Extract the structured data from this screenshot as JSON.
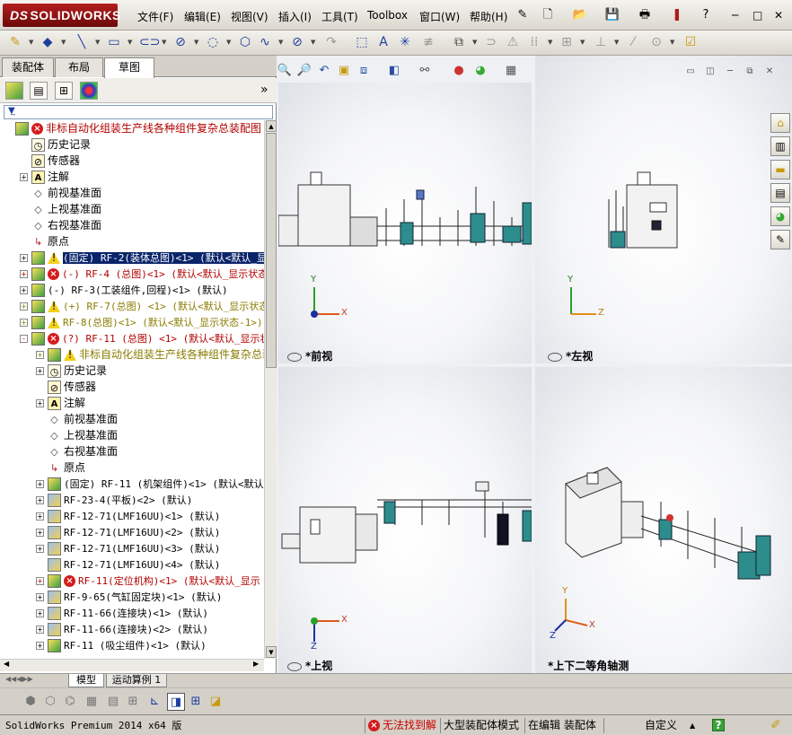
{
  "app": {
    "logo_text": "SOLIDWORKS",
    "logo_prefix": "DS",
    "brand_color": "#8b1414"
  },
  "menu": {
    "items": [
      "文件(F)",
      "编辑(E)",
      "视图(V)",
      "插入(I)",
      "工具(T)",
      "Toolbox",
      "窗口(W)",
      "帮助(H)"
    ]
  },
  "window_controls": {
    "minimize": "─",
    "restore": "□",
    "close": "✕"
  },
  "left_panel": {
    "tabs": [
      "装配体",
      "布局",
      "草图"
    ],
    "active_tab": "草图",
    "expand_symbol": "»",
    "tree": [
      {
        "label": "非标自动化组装生产线各种组件复杂总装配图",
        "icon": "asm",
        "status": "error",
        "color": "red",
        "indent": 0
      },
      {
        "label": "历史记录",
        "icon": "hist",
        "indent": 1
      },
      {
        "label": "传感器",
        "icon": "sens",
        "indent": 1
      },
      {
        "label": "注解",
        "icon": "ann",
        "indent": 1,
        "expander": "+"
      },
      {
        "label": "前视基准面",
        "icon": "plane",
        "indent": 1
      },
      {
        "label": "上视基准面",
        "icon": "plane",
        "indent": 1
      },
      {
        "label": "右视基准面",
        "icon": "plane",
        "indent": 1
      },
      {
        "label": "原点",
        "icon": "origin",
        "indent": 1
      },
      {
        "label": "(固定) RF-2(装体总图)<1> (默认<默认_显",
        "icon": "asm",
        "status": "warn",
        "indent": 1,
        "expander": "+",
        "selected": true
      },
      {
        "label": "(-) RF-4 (总图)<1> (默认<默认_显示状态",
        "icon": "asm",
        "status": "error",
        "color": "red",
        "indent": 1,
        "expander": "+"
      },
      {
        "label": "(-) RF-3(工装组件,回程)<1> (默认)",
        "icon": "asm",
        "indent": 1,
        "expander": "+"
      },
      {
        "label": "(+) RF-7(总图) <1> (默认<默认_显示状态",
        "icon": "asm",
        "status": "warn",
        "color": "olive",
        "indent": 1,
        "expander": "+"
      },
      {
        "label": "RF-8(总图)<1> (默认<默认_显示状态-1>)",
        "icon": "asm",
        "status": "warn",
        "color": "olive",
        "indent": 1,
        "expander": "+"
      },
      {
        "label": "(?) RF-11 (总图) <1> (默认<默认_显示状",
        "icon": "asm",
        "status": "error",
        "color": "red",
        "indent": 1,
        "expander": "-"
      },
      {
        "label": "非标自动化组装生产线各种组件复杂总装",
        "icon": "asm",
        "status": "warn",
        "color": "olive",
        "indent": 2,
        "expander": "+"
      },
      {
        "label": "历史记录",
        "icon": "hist",
        "indent": 2,
        "expander": "+"
      },
      {
        "label": "传感器",
        "icon": "sens",
        "indent": 2
      },
      {
        "label": "注解",
        "icon": "ann",
        "indent": 2,
        "expander": "+"
      },
      {
        "label": "前视基准面",
        "icon": "plane",
        "indent": 2
      },
      {
        "label": "上视基准面",
        "icon": "plane",
        "indent": 2
      },
      {
        "label": "右视基准面",
        "icon": "plane",
        "indent": 2
      },
      {
        "label": "原点",
        "icon": "origin",
        "indent": 2
      },
      {
        "label": "(固定) RF-11 (机架组件)<1> (默认<默认.",
        "icon": "asm",
        "indent": 2,
        "expander": "+"
      },
      {
        "label": "RF-23-4(平板)<2> (默认)",
        "icon": "part",
        "indent": 2,
        "expander": "+"
      },
      {
        "label": "RF-12-71(LMF16UU)<1> (默认)",
        "icon": "part",
        "indent": 2,
        "expander": "+"
      },
      {
        "label": "RF-12-71(LMF16UU)<2> (默认)",
        "icon": "part",
        "indent": 2,
        "expander": "+"
      },
      {
        "label": "RF-12-71(LMF16UU)<3> (默认)",
        "icon": "part",
        "indent": 2,
        "expander": "+"
      },
      {
        "label": "RF-12-71(LMF16UU)<4> (默认)",
        "icon": "part",
        "indent": 2
      },
      {
        "label": "RF-11(定位机构)<1> (默认<默认_显示",
        "icon": "asm",
        "status": "error",
        "color": "red",
        "indent": 2,
        "expander": "+"
      },
      {
        "label": "RF-9-65(气缸固定块)<1> (默认)",
        "icon": "part",
        "indent": 2,
        "expander": "+"
      },
      {
        "label": "RF-11-66(连接块)<1> (默认)",
        "icon": "part",
        "indent": 2,
        "expander": "+"
      },
      {
        "label": "RF-11-66(连接块)<2> (默认)",
        "icon": "part",
        "indent": 2,
        "expander": "+"
      },
      {
        "label": "RF-11 (吸尘组件)<1> (默认)",
        "icon": "asm",
        "indent": 2,
        "expander": "+"
      }
    ]
  },
  "bottom_tabs": [
    "模型",
    "运动算例 1"
  ],
  "viewports": [
    {
      "name": "*前视",
      "axes": [
        "Y",
        "X"
      ]
    },
    {
      "name": "*左视",
      "axes": [
        "Y",
        "Z"
      ]
    },
    {
      "name": "*上视",
      "axes": [
        "X",
        "Z"
      ]
    },
    {
      "name": "*上下二等角轴测",
      "axes": [
        "Y",
        "X",
        "Z"
      ]
    }
  ],
  "status_bar": {
    "version": "SolidWorks Premium 2014 x64 版",
    "error_text": "无法找到解",
    "mode": "大型装配体模式",
    "editing": "在编辑 装配体",
    "custom": "自定义",
    "help": "?"
  }
}
